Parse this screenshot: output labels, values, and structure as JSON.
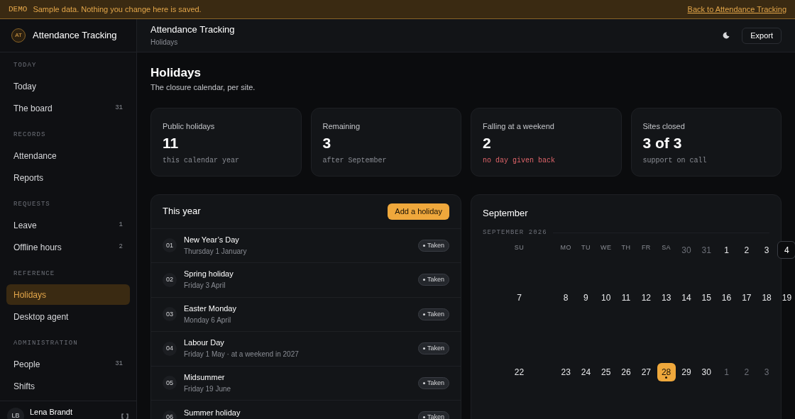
{
  "banner": {
    "tag": "DEMO",
    "message": "Sample data. Nothing you change here is saved.",
    "link": "Back to Attendance Tracking"
  },
  "brand": {
    "initials": "AT",
    "name": "Attendance Tracking"
  },
  "sidebar": {
    "sections": [
      {
        "heading": "TODAY",
        "items": [
          {
            "label": "Today",
            "selected": false
          },
          {
            "label": "The board",
            "count": "31",
            "selected": false
          }
        ]
      },
      {
        "heading": "RECORDS",
        "items": [
          {
            "label": "Attendance",
            "selected": false
          },
          {
            "label": "Reports",
            "selected": false
          }
        ]
      },
      {
        "heading": "REQUESTS",
        "items": [
          {
            "label": "Leave",
            "count": "1",
            "selected": false
          },
          {
            "label": "Offline hours",
            "count": "2",
            "selected": false
          }
        ]
      },
      {
        "heading": "REFERENCE",
        "items": [
          {
            "label": "Holidays",
            "selected": true
          },
          {
            "label": "Desktop agent",
            "selected": false
          }
        ]
      },
      {
        "heading": "ADMINISTRATION",
        "items": [
          {
            "label": "People",
            "count": "31",
            "selected": false
          },
          {
            "label": "Shifts",
            "selected": false
          }
        ]
      }
    ],
    "user": {
      "initials": "LB",
      "name": "Lena Brandt"
    }
  },
  "header": {
    "title": "Attendance Tracking",
    "breadcrumb": "Holidays",
    "export": "Export"
  },
  "page": {
    "title": "Holidays",
    "subtitle": "The closure calendar, per site."
  },
  "stats": [
    {
      "label": "Public holidays",
      "value": "11",
      "note": "this calendar year",
      "warning": false
    },
    {
      "label": "Remaining",
      "value": "3",
      "note": "after September",
      "warning": false
    },
    {
      "label": "Falling at a weekend",
      "value": "2",
      "note": "no day given back",
      "warning": true
    },
    {
      "label": "Sites closed",
      "value": "3 of 3",
      "note": "support on call",
      "warning": false
    }
  ],
  "year_list": {
    "title": "This year",
    "add_button": "Add a holiday",
    "items": [
      {
        "number": "01",
        "name": "New Year’s Day",
        "date": "Thursday 1 January",
        "status": "Taken"
      },
      {
        "number": "02",
        "name": "Spring holiday",
        "date": "Friday 3 April",
        "status": "Taken"
      },
      {
        "number": "03",
        "name": "Easter Monday",
        "date": "Monday 6 April",
        "status": "Taken"
      },
      {
        "number": "04",
        "name": "Labour Day",
        "date": "Friday 1 May · at a weekend in 2027",
        "status": "Taken"
      },
      {
        "number": "05",
        "name": "Midsummer",
        "date": "Friday 19 June",
        "status": "Taken"
      },
      {
        "number": "06",
        "name": "Summer holiday",
        "status": "Taken"
      }
    ]
  },
  "calendar": {
    "title": "September",
    "month_label": "SEPTEMBER 2026",
    "rows": [
      [
        {
          "kind": "weekday",
          "label": "SU"
        },
        {
          "kind": "weekday",
          "label": "MO"
        },
        {
          "kind": "weekday",
          "label": "TU"
        },
        {
          "kind": "weekday",
          "label": "WE"
        },
        {
          "kind": "weekday",
          "label": "TH"
        },
        {
          "kind": "weekday",
          "label": "FR"
        },
        {
          "kind": "weekday",
          "label": "SA"
        },
        {
          "kind": "outside",
          "label": "30"
        },
        {
          "kind": "outside",
          "label": "31"
        },
        {
          "kind": "day",
          "label": "1"
        },
        {
          "kind": "day",
          "label": "2"
        },
        {
          "kind": "day",
          "label": "3"
        },
        {
          "kind": "today",
          "label": "4"
        }
      ],
      [
        {
          "kind": "day",
          "label": "7"
        },
        {
          "kind": "day",
          "label": "8"
        },
        {
          "kind": "day",
          "label": "9"
        },
        {
          "kind": "day",
          "label": "10"
        },
        {
          "kind": "day",
          "label": "11"
        },
        {
          "kind": "day",
          "label": "12"
        },
        {
          "kind": "day",
          "label": "13"
        },
        {
          "kind": "day",
          "label": "14"
        },
        {
          "kind": "day",
          "label": "15"
        },
        {
          "kind": "day",
          "label": "16"
        },
        {
          "kind": "day",
          "label": "17"
        },
        {
          "kind": "day",
          "label": "18"
        },
        {
          "kind": "day",
          "label": "19"
        }
      ],
      [
        {
          "kind": "day",
          "label": "22"
        },
        {
          "kind": "day",
          "label": "23"
        },
        {
          "kind": "day",
          "label": "24"
        },
        {
          "kind": "day",
          "label": "25"
        },
        {
          "kind": "day",
          "label": "26"
        },
        {
          "kind": "day",
          "label": "27"
        },
        {
          "kind": "selected",
          "label": "28"
        },
        {
          "kind": "day",
          "label": "29"
        },
        {
          "kind": "day",
          "label": "30"
        },
        {
          "kind": "outside",
          "label": "1"
        },
        {
          "kind": "outside",
          "label": "2"
        },
        {
          "kind": "outside",
          "label": "3"
        }
      ]
    ]
  }
}
